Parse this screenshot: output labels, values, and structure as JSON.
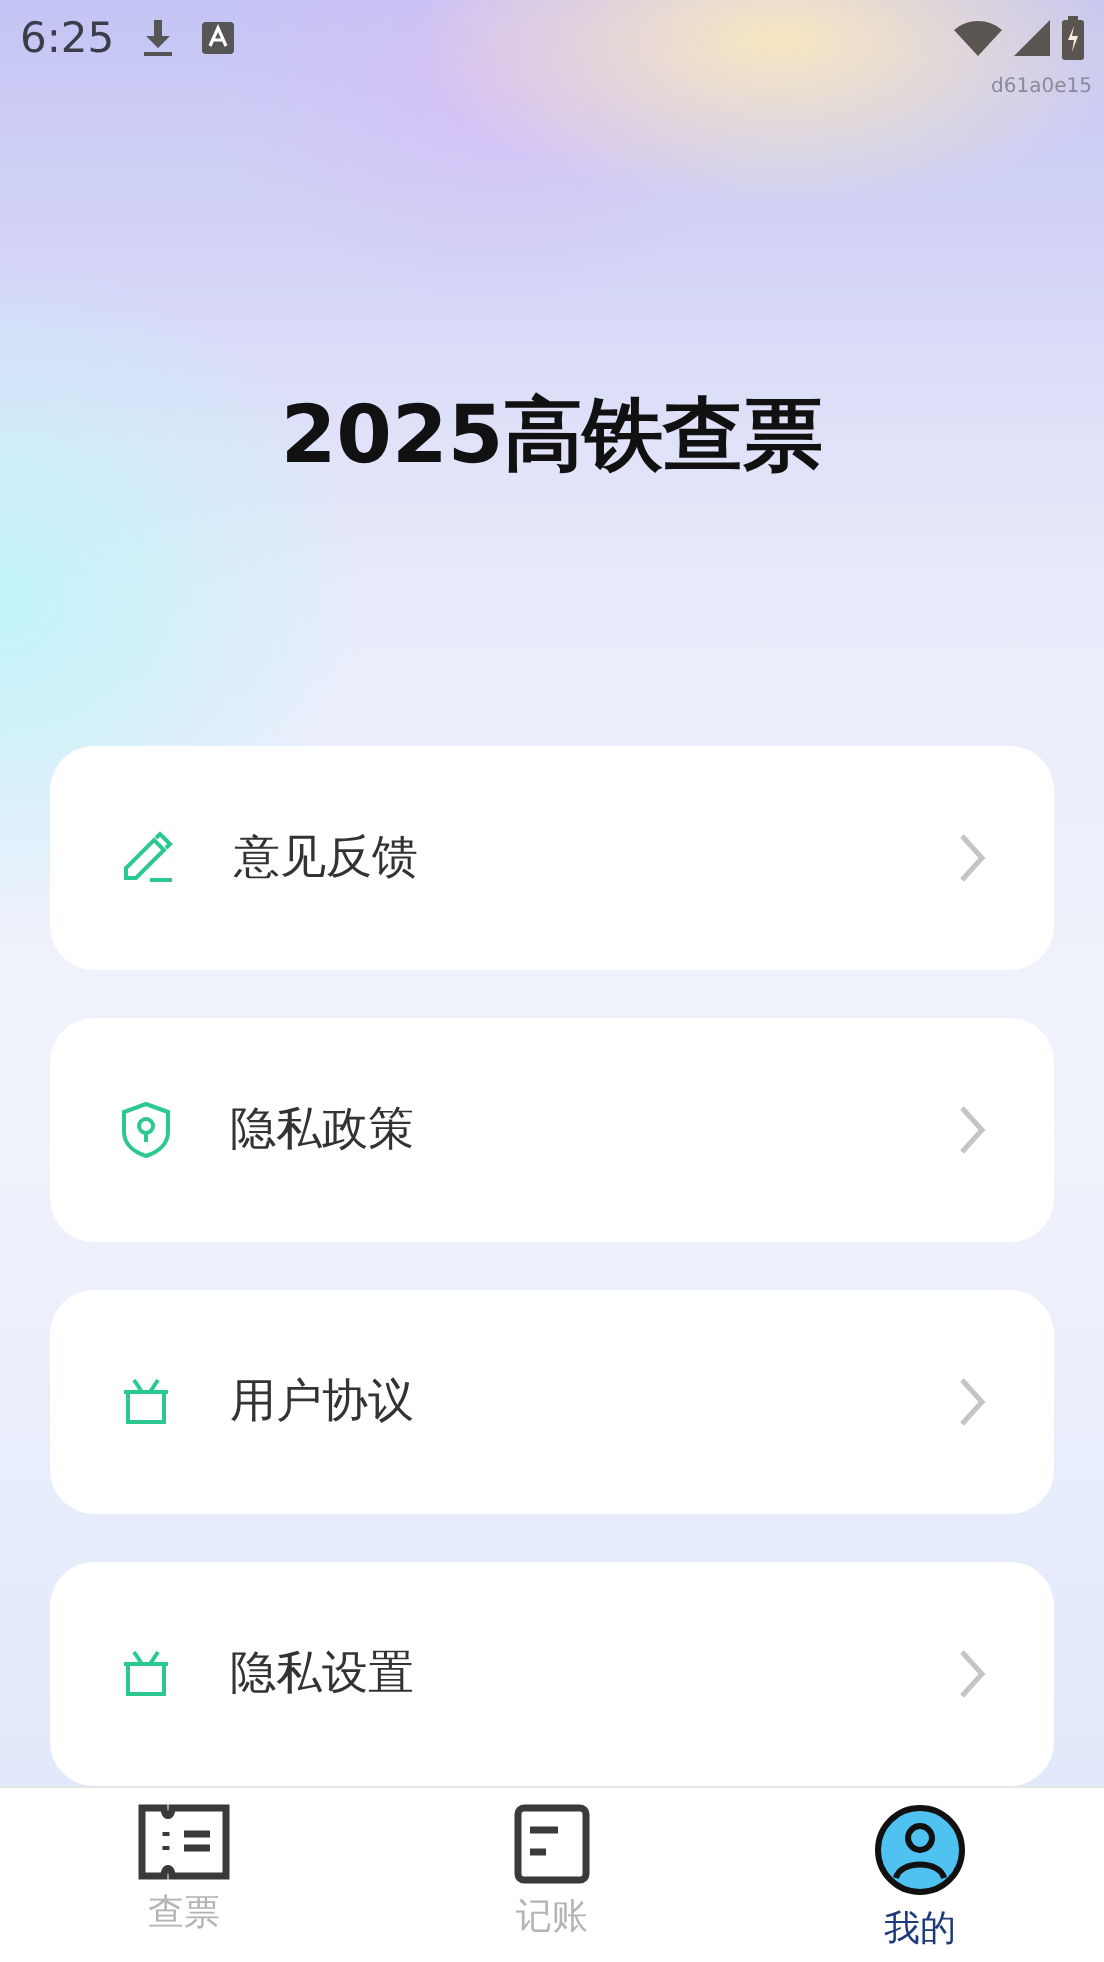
{
  "status_bar": {
    "time": "6:25",
    "tag": "d61a0e15"
  },
  "title": "2025高铁查票",
  "menu": [
    {
      "label": "意见反馈"
    },
    {
      "label": "隐私政策"
    },
    {
      "label": "用户协议"
    },
    {
      "label": "隐私设置"
    }
  ],
  "tabs": [
    {
      "label": "查票",
      "selected": false
    },
    {
      "label": "记账",
      "selected": false
    },
    {
      "label": "我的",
      "selected": true
    }
  ]
}
